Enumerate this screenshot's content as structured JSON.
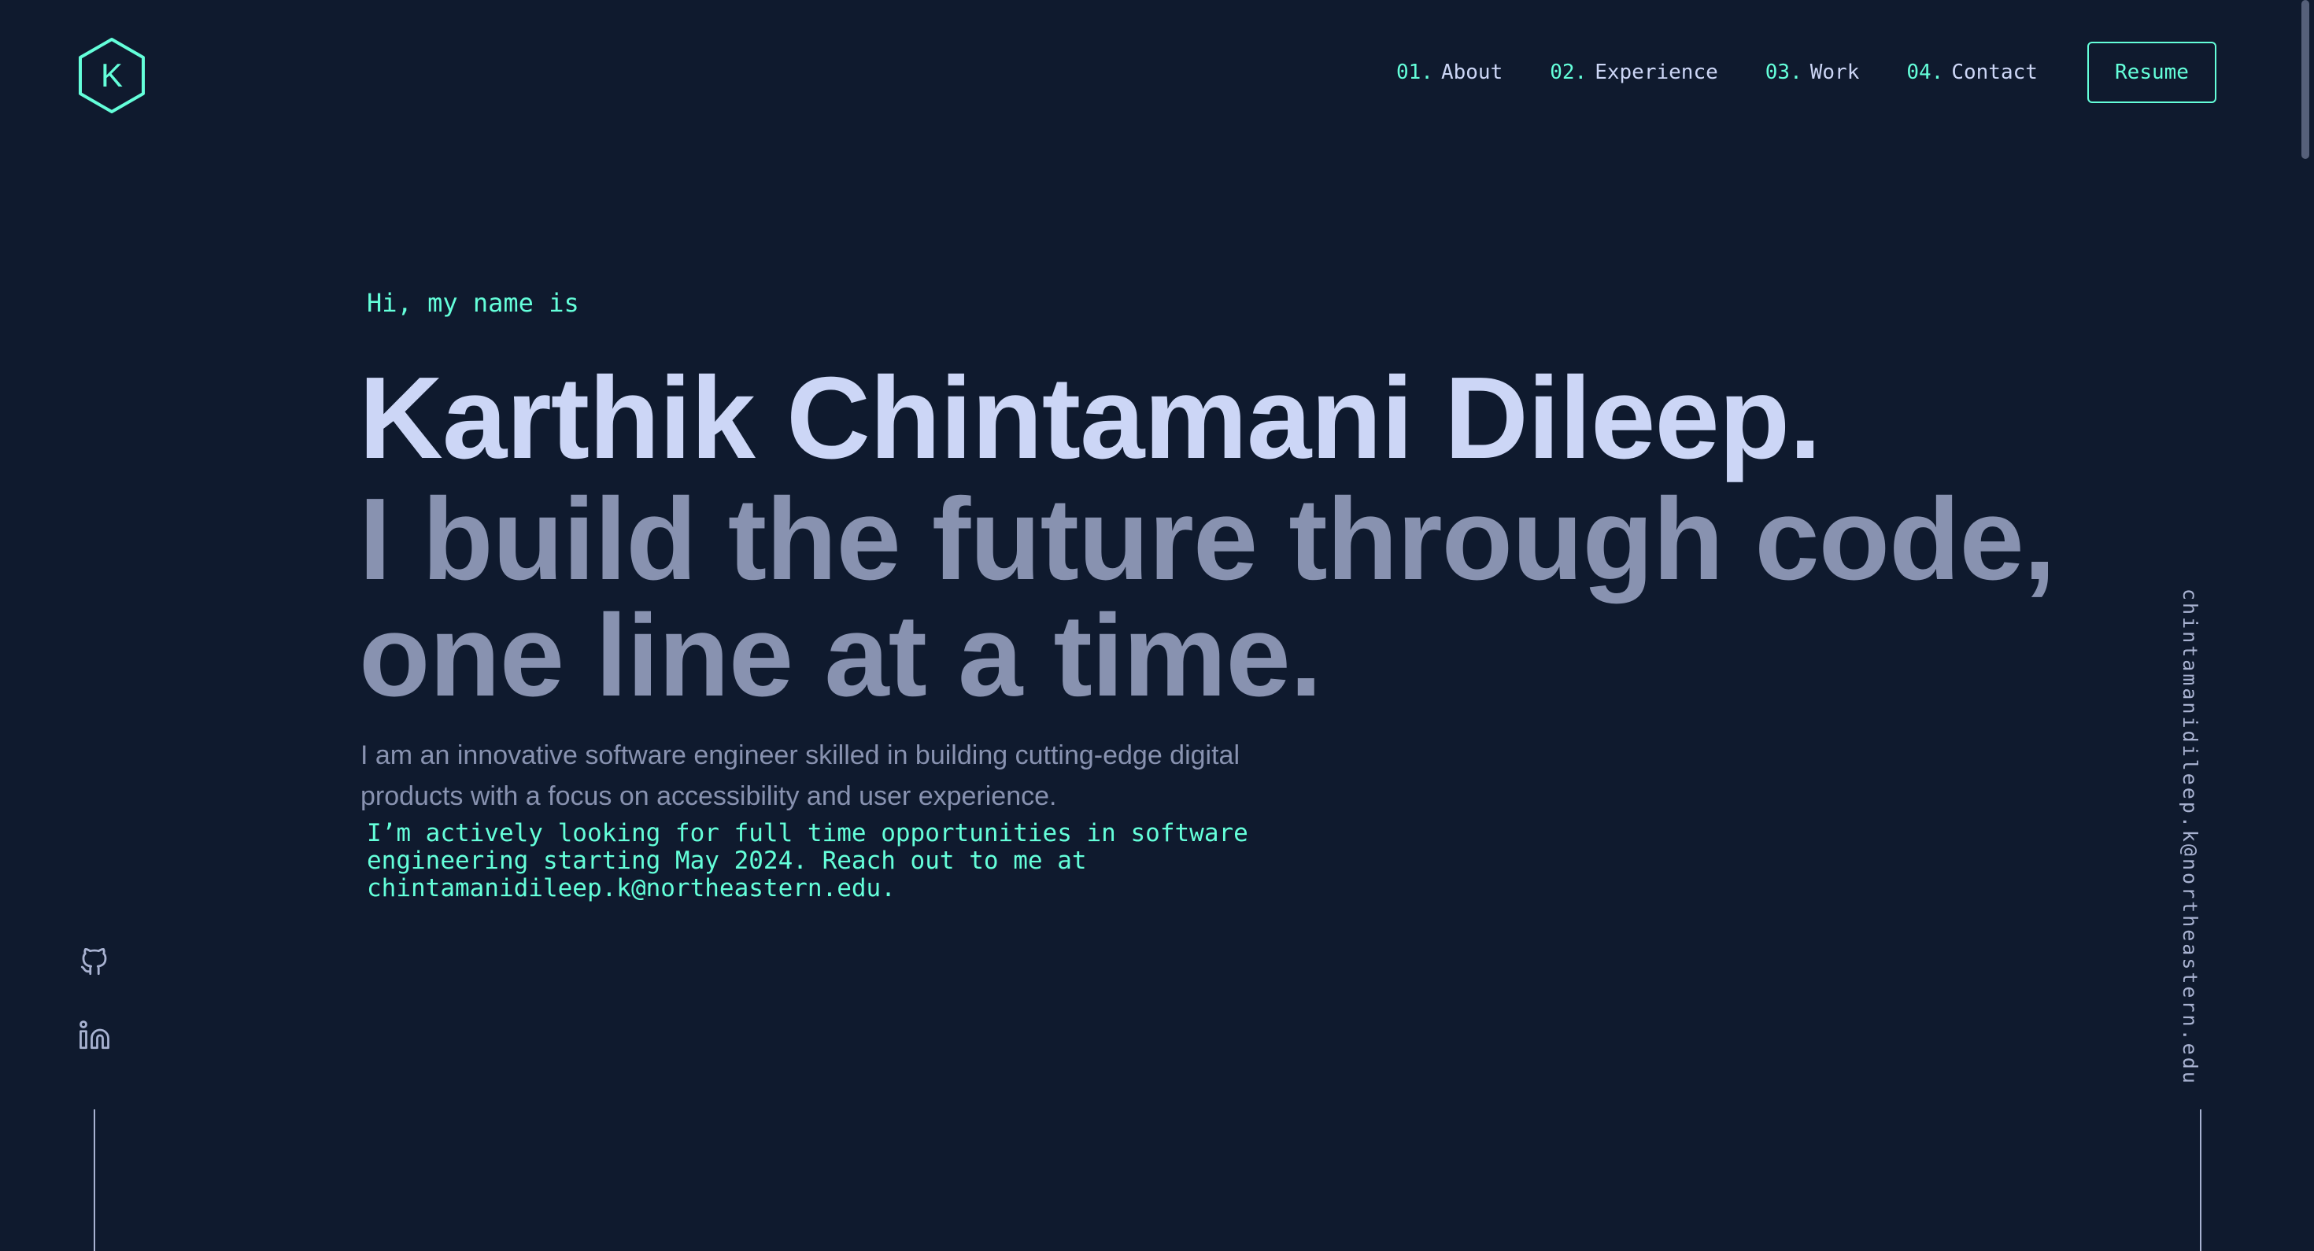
{
  "header": {
    "logo_letter": "K",
    "nav": [
      {
        "number": "01.",
        "label": "About"
      },
      {
        "number": "02.",
        "label": "Experience"
      },
      {
        "number": "03.",
        "label": "Work"
      },
      {
        "number": "04.",
        "label": "Contact"
      }
    ],
    "resume_label": "Resume"
  },
  "hero": {
    "greeting": "Hi, my name is",
    "name": "Karthik Chintamani Dileep.",
    "tagline_line1": "I build the future through code,",
    "tagline_line2": "one line at a time.",
    "intro": "I am an innovative software engineer skilled in building cutting-edge digital products with a focus on accessibility and user experience.",
    "availability": "I’m actively looking for full time opportunities in software engineering starting May 2024. Reach out to me at chintamanidileep.k@northeastern.edu."
  },
  "social": {
    "icons": [
      "github-icon",
      "linkedin-icon"
    ]
  },
  "side_email": "chintamanidileep.k@northeastern.edu",
  "colors": {
    "background": "#0f1a2e",
    "accent": "#64ffda",
    "heading": "#ccd6f6",
    "muted": "#8892b0"
  }
}
